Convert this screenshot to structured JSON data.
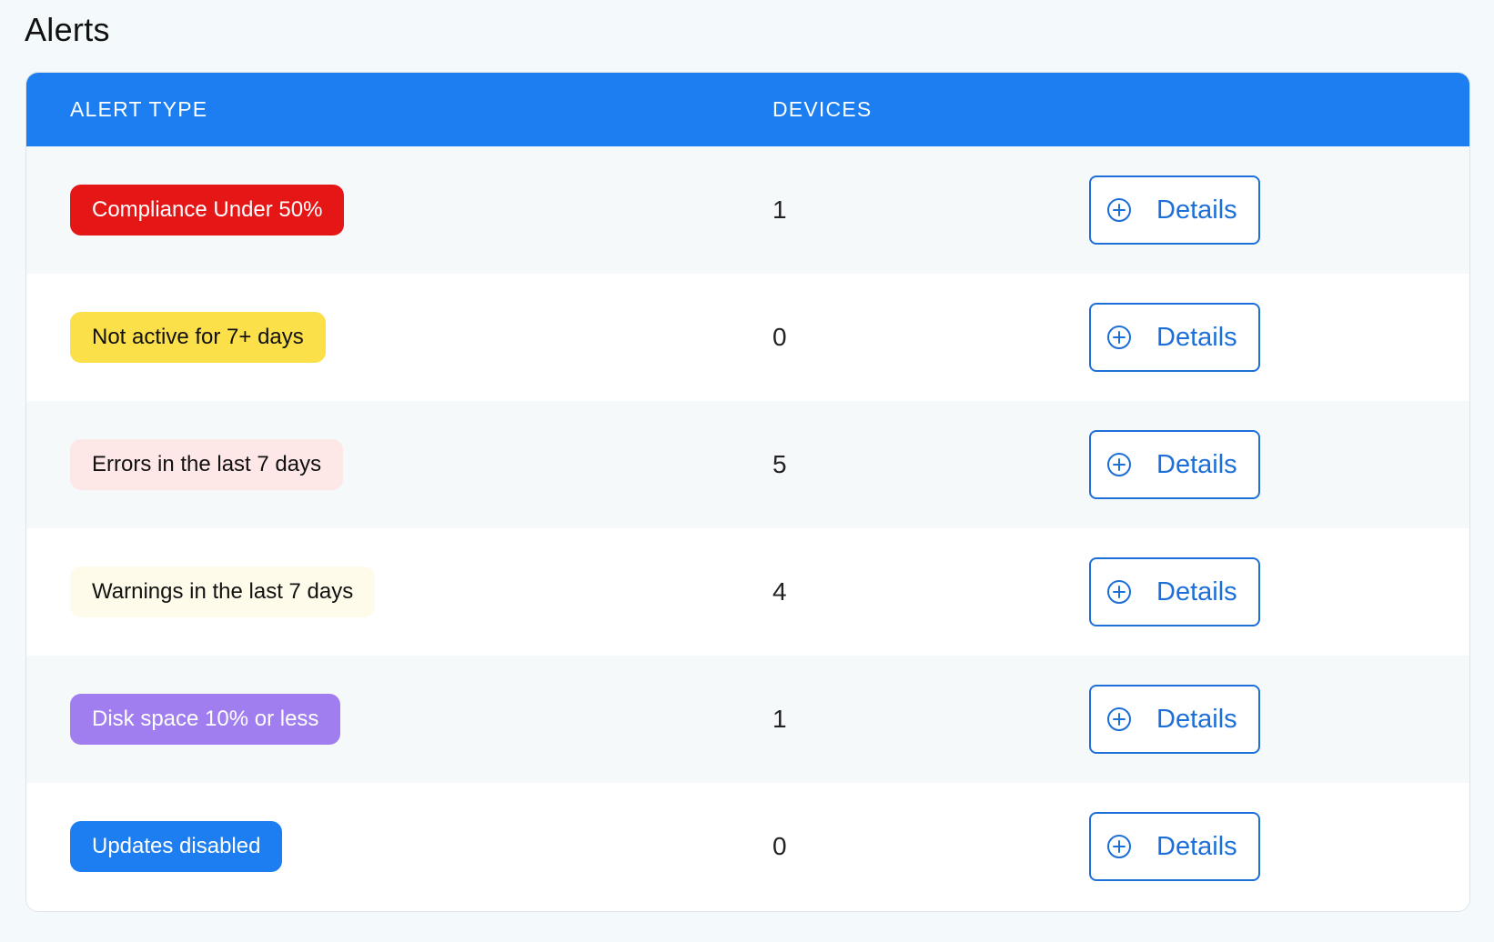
{
  "page": {
    "title": "Alerts"
  },
  "table": {
    "headers": {
      "alert_type": "ALERT TYPE",
      "devices": "DEVICES"
    },
    "rows": [
      {
        "label": "Compliance Under 50%",
        "count": "1",
        "details_label": "Details",
        "pill_bg": "#e41616",
        "pill_fg": "#ffffff"
      },
      {
        "label": "Not active for 7+ days",
        "count": "0",
        "details_label": "Details",
        "pill_bg": "#fbe04a",
        "pill_fg": "#111111"
      },
      {
        "label": "Errors in the last 7 days",
        "count": "5",
        "details_label": "Details",
        "pill_bg": "#fde7e7",
        "pill_fg": "#111111"
      },
      {
        "label": "Warnings in the last 7 days",
        "count": "4",
        "details_label": "Details",
        "pill_bg": "#fffbeb",
        "pill_fg": "#111111"
      },
      {
        "label": "Disk space 10% or less",
        "count": "1",
        "details_label": "Details",
        "pill_bg": "#a07ef0",
        "pill_fg": "#ffffff"
      },
      {
        "label": "Updates disabled",
        "count": "0",
        "details_label": "Details",
        "pill_bg": "#1c7ef0",
        "pill_fg": "#ffffff"
      }
    ]
  },
  "colors": {
    "header_bg": "#1c7ef0",
    "accent": "#1c6fd8"
  },
  "icons": {
    "details": "plus-circle-icon"
  }
}
